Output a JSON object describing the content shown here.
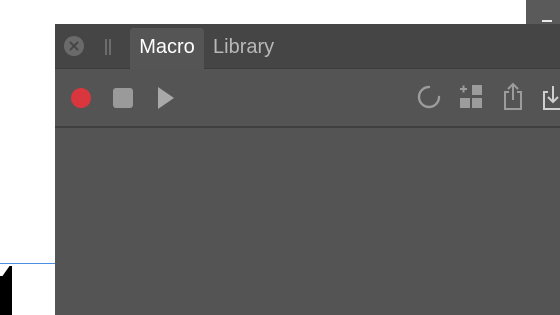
{
  "panel": {
    "tabs": [
      {
        "label": "Macro",
        "active": true
      },
      {
        "label": "Library",
        "active": false
      }
    ]
  },
  "toolbar": {
    "buttons": [
      {
        "icon": "record-icon",
        "color": "#d9363e"
      },
      {
        "icon": "stop-icon"
      },
      {
        "icon": "play-icon"
      },
      {
        "icon": "reload-icon"
      },
      {
        "icon": "add-grid-icon"
      },
      {
        "icon": "share-icon"
      },
      {
        "icon": "import-icon"
      }
    ]
  },
  "colors": {
    "panel_bg": "#545454",
    "tabbar_bg": "#454545",
    "accent_record": "#d9363e",
    "selection_line": "#4a90e2"
  }
}
